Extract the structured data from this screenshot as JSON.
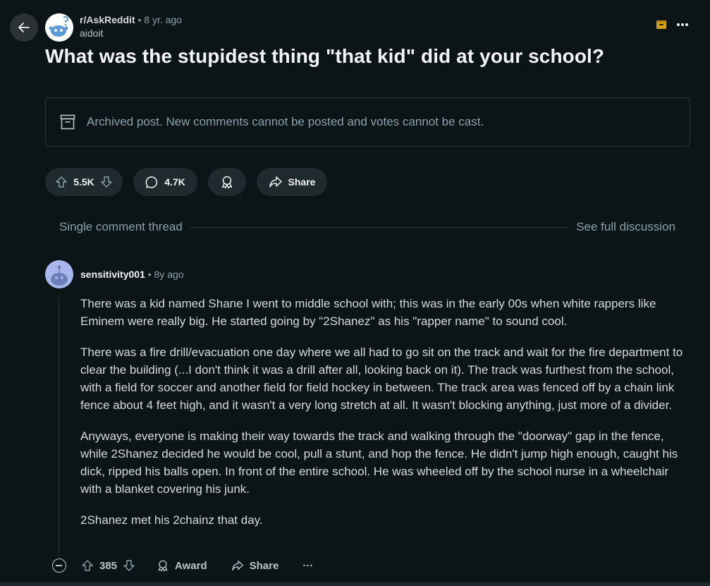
{
  "post": {
    "subreddit": "r/AskReddit",
    "separator": "•",
    "age": "8 yr. ago",
    "author": "aidoit",
    "title": "What was the stupidest thing \"that kid\" did at your school?",
    "archived_notice": "Archived post. New comments cannot be posted and votes cannot be cast.",
    "votes": "5.5K",
    "comments": "4.7K",
    "share_label": "Share"
  },
  "thread": {
    "single_label": "Single comment thread",
    "full_label": "See full discussion"
  },
  "comment": {
    "username": "sensitivity001",
    "separator": "•",
    "age": "8y ago",
    "paragraphs": [
      "There was a kid named Shane I went to middle school with; this was in the early 00s when white rappers like Eminem were really big. He started going by \"2Shanez\" as his \"rapper name\" to sound cool.",
      "There was a fire drill/evacuation one day where we all had to go sit on the track and wait for the fire department to clear the building (...I don't think it was a drill after all, looking back on it). The track was furthest from the school, with a field for soccer and another field for field hockey in between. The track area was fenced off by a chain link fence about 4 feet high, and it wasn't a very long stretch at all. It wasn't blocking anything, just more of a divider.",
      "Anyways, everyone is making their way towards the track and walking through the \"doorway\" gap in the fence, while 2Shanez decided he would be cool, pull a stunt, and hop the fence. He didn't jump high enough, caught his dick, ripped his balls open. In front of the entire school. He was wheeled off by the school nurse in a wheelchair with a blanket covering his junk.",
      "2Shanez met his 2chainz that day."
    ],
    "votes": "385",
    "award_label": "Award",
    "share_label": "Share",
    "more_label": "···"
  },
  "icons": {
    "back": "arrow-left-icon",
    "archive": "archive-box-icon",
    "more": "ellipsis-icon",
    "upvote": "arrow-up-icon",
    "downvote": "arrow-down-icon",
    "comment": "speech-bubble-icon",
    "award": "award-ribbon-icon",
    "share": "share-arrow-icon",
    "collapse": "minus-circle-icon"
  },
  "colors": {
    "background": "#0b1416",
    "pill": "#1f2a2e",
    "archive_badge": "#d4a017",
    "muted_text": "#8ba2ad"
  }
}
